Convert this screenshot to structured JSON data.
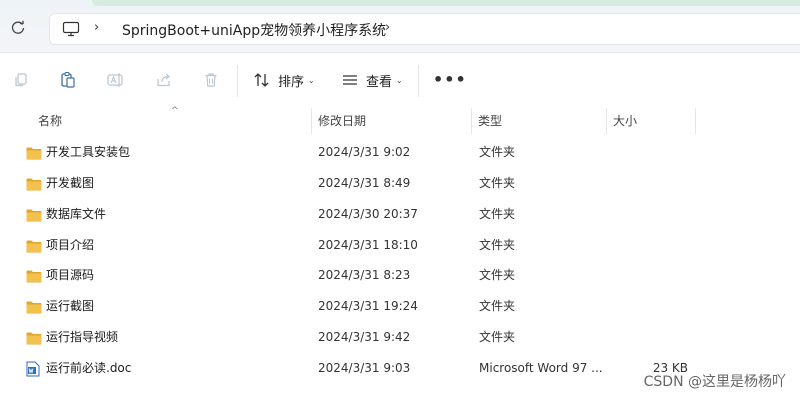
{
  "address": {
    "breadcrumb": "SpringBoot+uniApp宠物领养小程序系统"
  },
  "toolbar": {
    "sort_label": "排序",
    "view_label": "查看"
  },
  "columns": {
    "name": "名称",
    "modified": "修改日期",
    "type": "类型",
    "size": "大小"
  },
  "files": [
    {
      "name": "开发工具安装包",
      "modified": "2024/3/31 9:02",
      "type": "文件夹",
      "size": "",
      "icon": "folder-icon"
    },
    {
      "name": "开发截图",
      "modified": "2024/3/31 8:49",
      "type": "文件夹",
      "size": "",
      "icon": "folder-icon"
    },
    {
      "name": "数据库文件",
      "modified": "2024/3/30 20:37",
      "type": "文件夹",
      "size": "",
      "icon": "folder-icon"
    },
    {
      "name": "项目介绍",
      "modified": "2024/3/31 18:10",
      "type": "文件夹",
      "size": "",
      "icon": "folder-icon"
    },
    {
      "name": "项目源码",
      "modified": "2024/3/31 8:23",
      "type": "文件夹",
      "size": "",
      "icon": "folder-icon"
    },
    {
      "name": "运行截图",
      "modified": "2024/3/31 19:24",
      "type": "文件夹",
      "size": "",
      "icon": "folder-icon"
    },
    {
      "name": "运行指导视频",
      "modified": "2024/3/31 9:42",
      "type": "文件夹",
      "size": "",
      "icon": "folder-icon"
    },
    {
      "name": "运行前必读.doc",
      "modified": "2024/3/31 9:03",
      "type": "Microsoft Word 97 ...",
      "size": "23 KB",
      "icon": "word-doc-icon"
    }
  ],
  "watermark": "CSDN @这里是杨杨吖",
  "colors": {
    "folder": "#f2c14e",
    "folder_dark": "#e0a82e",
    "word_blue": "#2b6cc4",
    "accent_strip": "#d6ecdf"
  }
}
